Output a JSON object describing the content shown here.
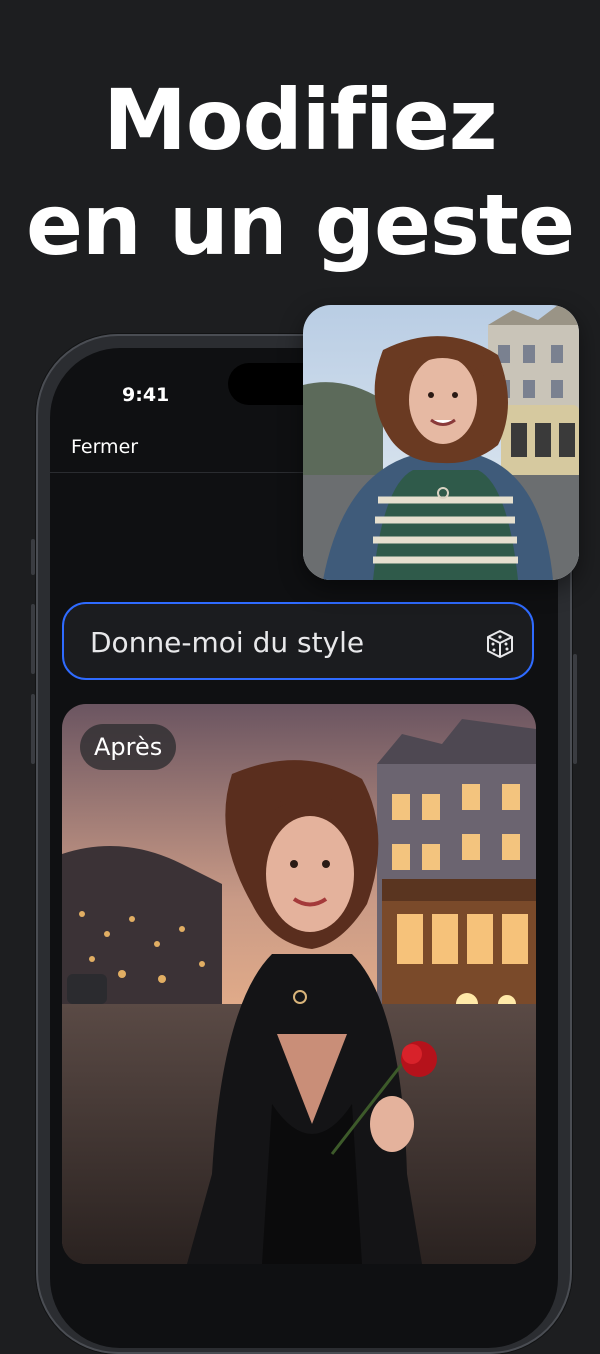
{
  "headline": {
    "line1": "Modifiez",
    "line2": "en un geste"
  },
  "status_bar": {
    "time": "9:41"
  },
  "nav": {
    "close_label": "Fermer"
  },
  "prompt": {
    "text": "Donne-moi du style",
    "icon": "dice-icon"
  },
  "after_image": {
    "badge": "Après"
  },
  "before_image": {
    "icon": "photo-before"
  },
  "colors": {
    "accent": "#2f6bff",
    "background": "#1d1e20",
    "screen": "#0f1012"
  }
}
